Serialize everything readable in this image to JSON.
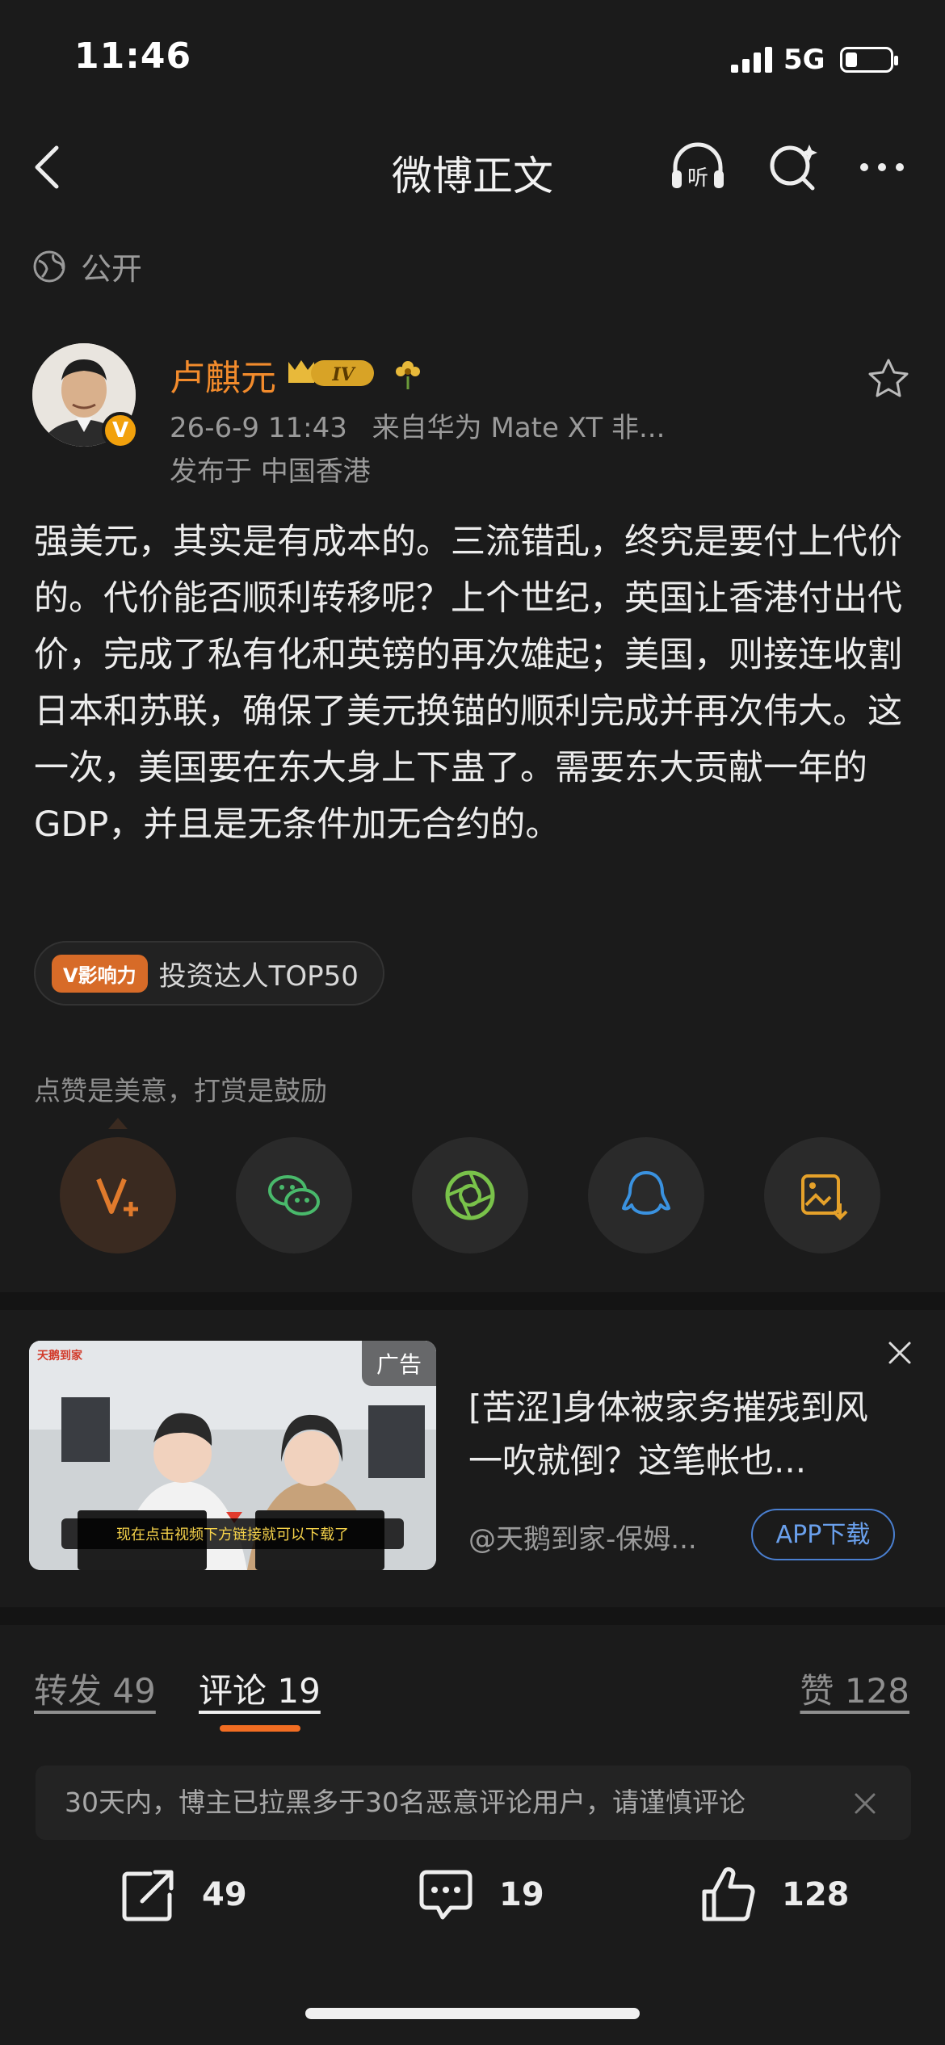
{
  "status_bar": {
    "time": "11:46",
    "network": "5G"
  },
  "nav": {
    "title": "微博正文"
  },
  "visibility": "公开",
  "post": {
    "author": "卢麒元",
    "time": "26-6-9 11:43",
    "source": "来自华为 Mate XT 非...",
    "location": "发布于 中国香港",
    "content": "强美元，其实是有成本的。三流错乱，终究是要付上代价的。代价能否顺利转移呢？上个世纪，英国让香港付出代价，完成了私有化和英镑的再次雄起；美国，则接连收割日本和苏联，确保了美元换锚的顺利完成并再次伟大。这一次，美国要在东大身上下蛊了。需要东大贡献一年的GDP，并且是无条件加无合约的。",
    "influence_badge": "V影响力",
    "influence_label": "投资达人TOP50"
  },
  "reward_hint": "点赞是美意，打赏是鼓励",
  "ad": {
    "label": "广告",
    "title": "[苦涩]身体被家务摧残到风一吹就倒？这笔帐也...",
    "source": "@天鹅到家-保姆...",
    "button": "APP下载",
    "caption": "现在点击视频下方链接就可以下载了",
    "brand": "天鹅到家"
  },
  "tabs": {
    "repost": "转发 49",
    "comment": "评论 19",
    "like": "赞 128"
  },
  "notice": "30天内，博主已拉黑多于30名恶意评论用户，请谨慎评论",
  "actions": {
    "repost_count": "49",
    "comment_count": "19",
    "like_count": "128"
  },
  "colors": {
    "accent": "#f26d22",
    "username": "#f28b2c",
    "link": "#6aa0ec"
  }
}
